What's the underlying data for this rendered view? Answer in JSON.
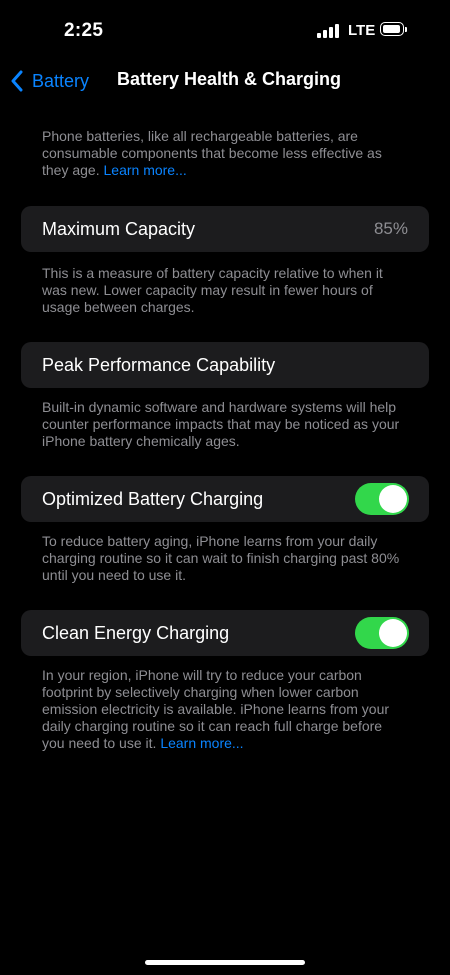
{
  "status_bar": {
    "time": "2:25",
    "network": "LTE",
    "signal_icon": "cellular-signal-icon",
    "battery_icon": "battery-icon"
  },
  "nav": {
    "back_label": "Battery",
    "title": "Battery Health & Charging",
    "back_icon": "chevron-left-icon"
  },
  "intro": {
    "text": "Phone batteries, like all rechargeable batteries, are consumable components that become less effective as they age.",
    "link": "Learn more..."
  },
  "maximum_capacity": {
    "label": "Maximum Capacity",
    "value": "85%",
    "footnote": "This is a measure of battery capacity relative to when it was new. Lower capacity may result in fewer hours of usage between charges."
  },
  "peak_performance": {
    "label": "Peak Performance Capability",
    "footnote": "Built-in dynamic software and hardware systems will help counter performance impacts that may be noticed as your iPhone battery chemically ages."
  },
  "optimized_charging": {
    "label": "Optimized Battery Charging",
    "enabled": true,
    "footnote": "To reduce battery aging, iPhone learns from your daily charging routine so it can wait to finish charging past 80% until you need to use it."
  },
  "clean_energy": {
    "label": "Clean Energy Charging",
    "enabled": true,
    "footnote": "In your region, iPhone will try to reduce your carbon footprint by selectively charging when lower carbon emission electricity is available. iPhone learns from your daily charging routine so it can reach full charge before you need to use it.",
    "link": "Learn more..."
  },
  "colors": {
    "accent": "#0a84ff",
    "toggle_on": "#32d74b",
    "cell_bg": "#1c1c1e",
    "secondary_text": "#8e8e93"
  }
}
